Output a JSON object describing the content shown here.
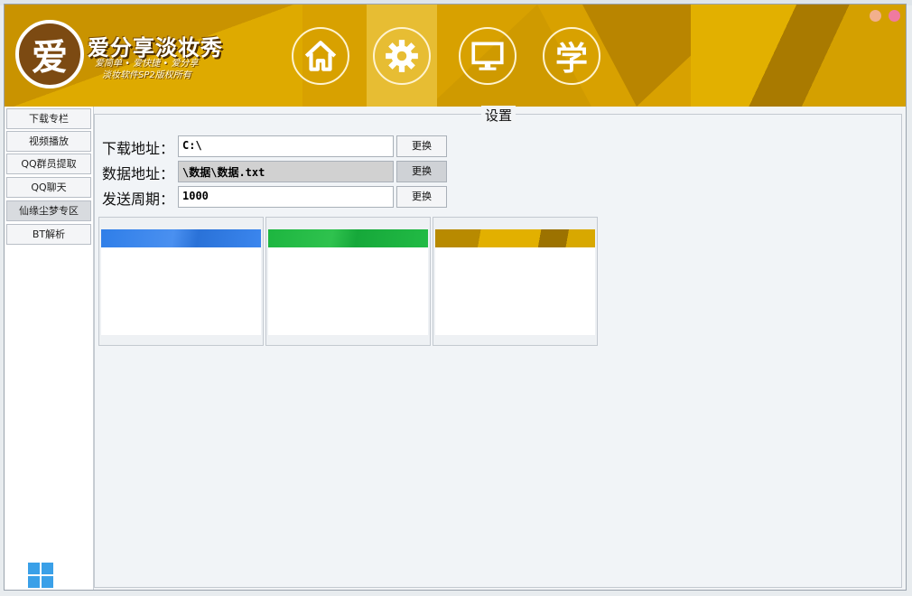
{
  "app": {
    "brand_title": "爱分享淡妆秀",
    "brand_slogan": "爱简单 • 爱快捷 • 爱分享",
    "brand_copyright": "淡妆软件SP2版权所有",
    "logo_glyph": "爱"
  },
  "nav": {
    "items": [
      {
        "name": "home",
        "icon": "home-icon",
        "active": false
      },
      {
        "name": "settings",
        "icon": "gear-icon",
        "active": true
      },
      {
        "name": "monitor",
        "icon": "monitor-icon",
        "active": false
      },
      {
        "name": "learn",
        "icon": "xue-icon",
        "label": "学",
        "active": false
      }
    ]
  },
  "sidebar": {
    "items": [
      {
        "label": "下载专栏"
      },
      {
        "label": "视频播放"
      },
      {
        "label": "QQ群员提取"
      },
      {
        "label": "QQ聊天"
      },
      {
        "label": "仙缘尘梦专区",
        "active": true
      },
      {
        "label": "BT解析"
      }
    ]
  },
  "settings": {
    "title": "设置",
    "download_label": "下载地址：",
    "download_value": "C:\\",
    "data_label": "数据地址：",
    "data_value": "\\数据\\数据.txt",
    "period_label": "发送周期：",
    "period_value": "1000",
    "change_button": "更换"
  },
  "themes": {
    "colors": [
      "#2f7ee8",
      "#1db640",
      "#c9a200"
    ]
  },
  "colors": {
    "header": "#d8a100",
    "header_active": "#e7bd33",
    "min_dot": "#f2b08d",
    "close_dot": "#f07aa0"
  }
}
